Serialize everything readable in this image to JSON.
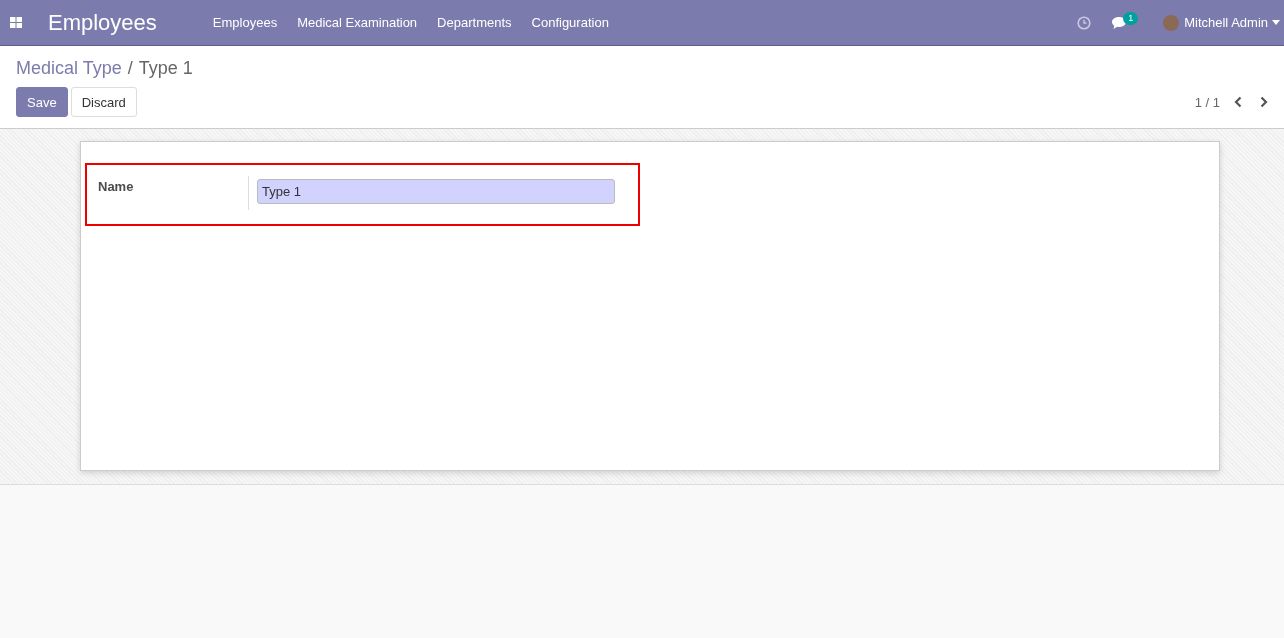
{
  "navbar": {
    "app_title": "Employees",
    "menu": [
      {
        "label": "Employees"
      },
      {
        "label": "Medical Examination"
      },
      {
        "label": "Departments"
      },
      {
        "label": "Configuration"
      }
    ],
    "messages_badge": "1",
    "user": "Mitchell Admin"
  },
  "breadcrumb_separator": "/",
  "breadcrumb": [
    {
      "label": "Medical Type"
    },
    {
      "label": "Type 1"
    }
  ],
  "buttons": [
    {
      "label": "Save",
      "kind": "primary"
    },
    {
      "label": "Discard",
      "kind": "secondary"
    }
  ],
  "pager": {
    "text": "1 / 1"
  },
  "form": {
    "highlighted": true,
    "fields": [
      {
        "label": "Name",
        "value": "Type 1"
      }
    ]
  }
}
